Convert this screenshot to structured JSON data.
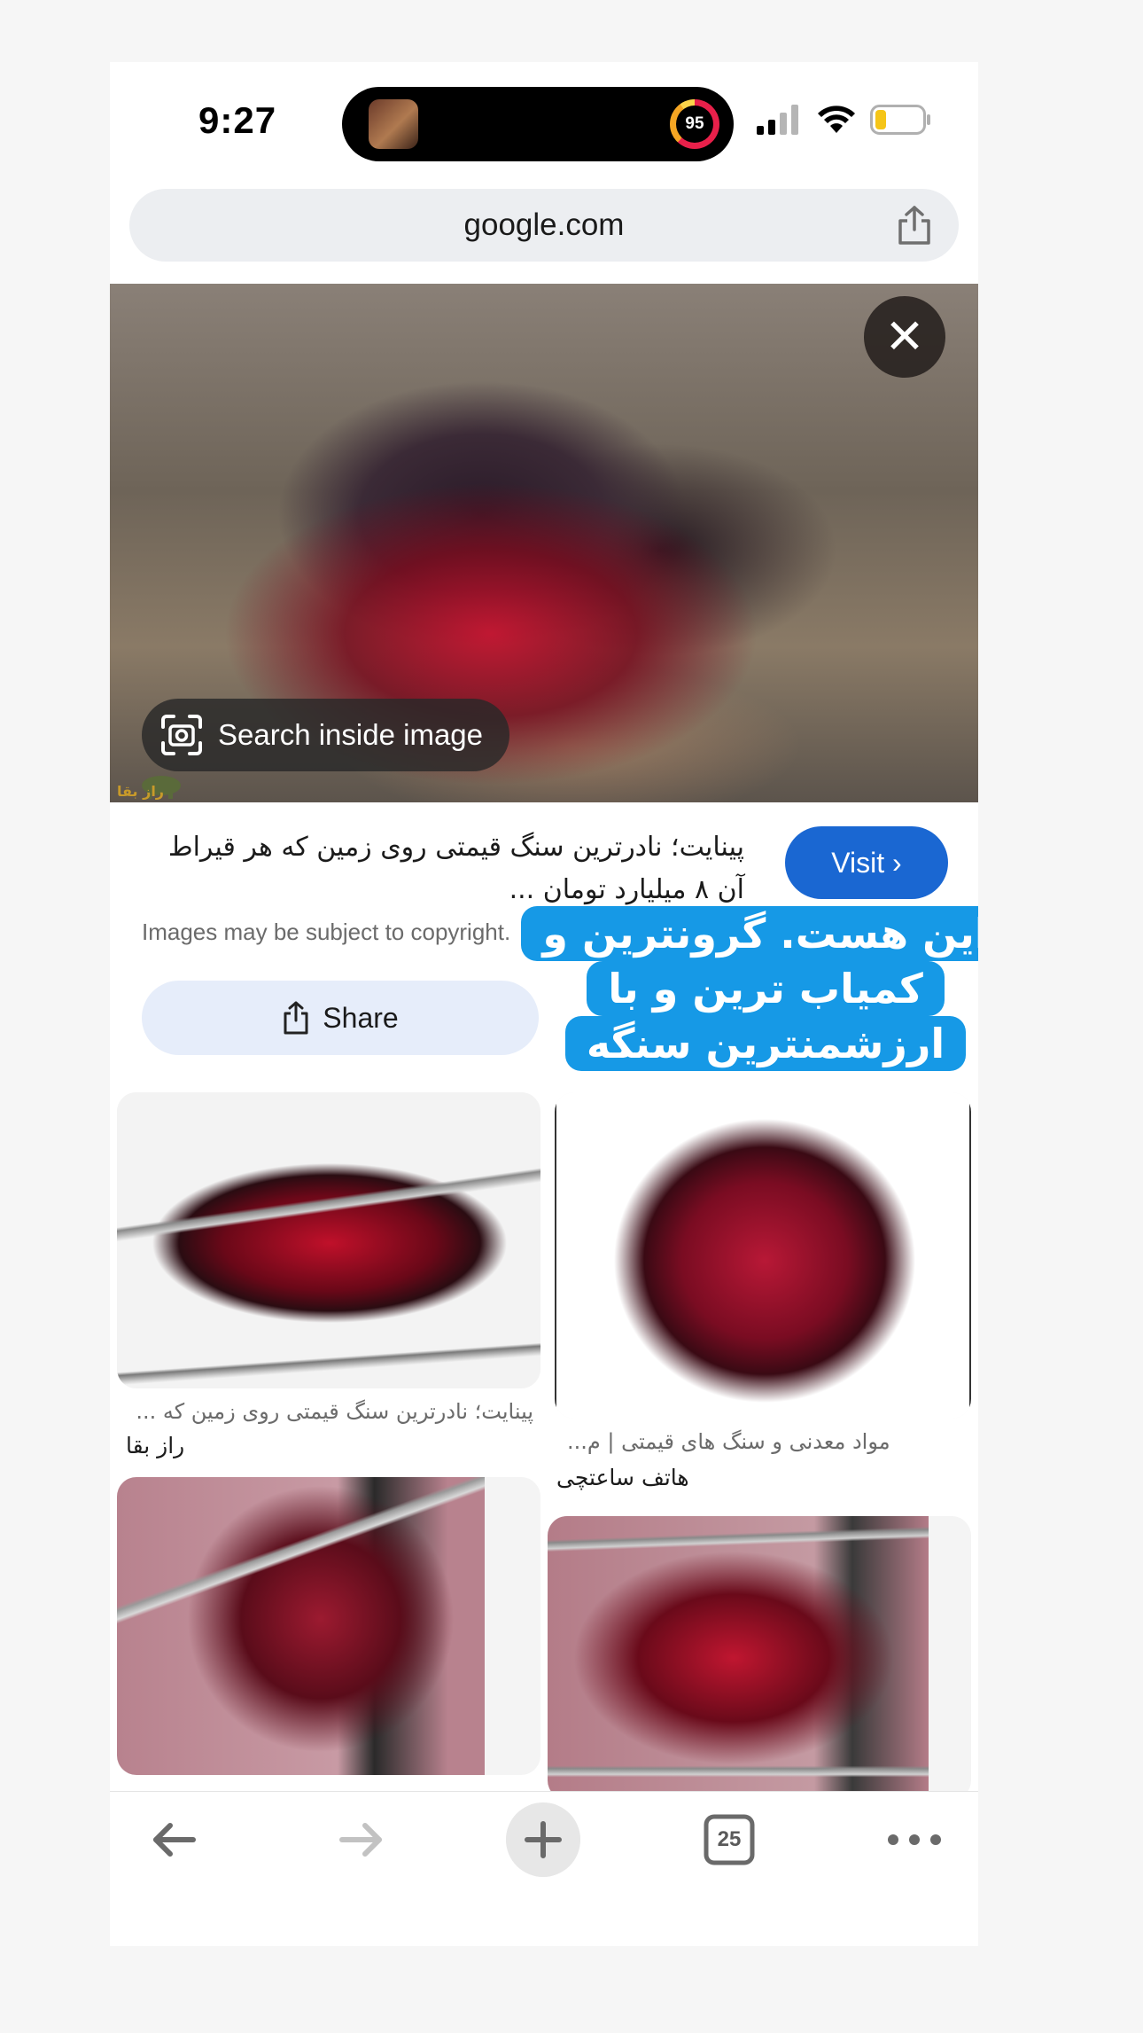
{
  "status_bar": {
    "time": "9:27",
    "activity_ring_value": "95",
    "icons": [
      "signal-icon",
      "wifi-icon",
      "battery-icon"
    ]
  },
  "browser": {
    "url": "google.com"
  },
  "image_viewer": {
    "search_inside_label": "Search inside image",
    "title": "پینایت؛ نادرترین سنگ قیمتی روی زمین که هر قیراط آن ۸ میلیارد تومان ...",
    "visit_label": "Visit",
    "copyright_notice": "Images may be subject to copyright.",
    "share_label": "Share",
    "logo_text": "راز بقا"
  },
  "overlay": {
    "text": "این هست. گرونترین و کمیاب ترین و با ارزشمنترین سنگه"
  },
  "results": [
    {
      "title": "پینایت؛ نادرترین سنگ قیمتی روی زمین که ...",
      "source": "راز بقا"
    },
    {
      "title": "مواد معدنی و سنگ های قیمتی | م...",
      "source": "هاتف ساعتچی"
    }
  ],
  "toolbar": {
    "tab_count": "25"
  },
  "colors": {
    "visit_button": "#1a67d2",
    "overlay_background": "#1699e6",
    "share_button": "#e6edfa"
  }
}
